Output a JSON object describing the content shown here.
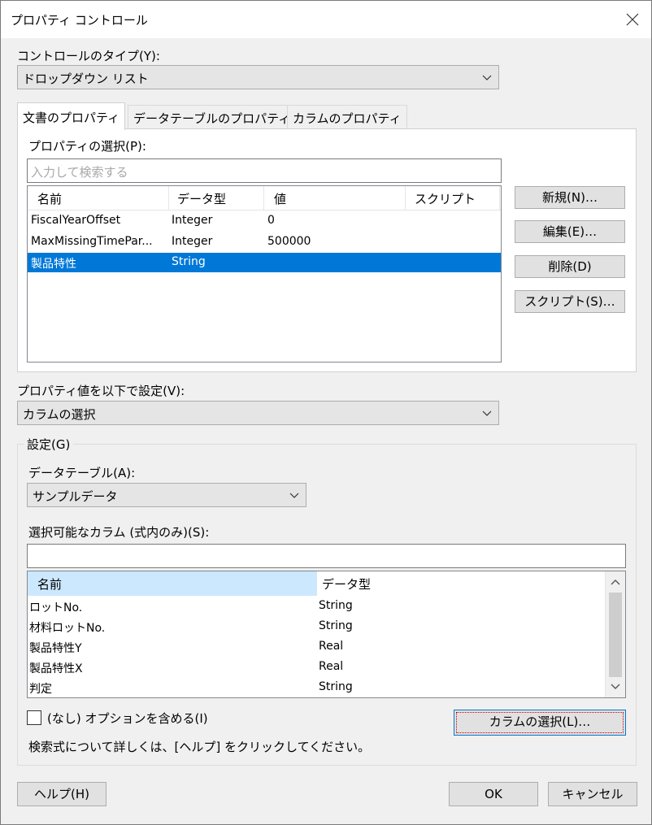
{
  "window": {
    "title": "プロパティ コントロール"
  },
  "control_type": {
    "label": "コントロールのタイプ(Y):",
    "value": "ドロップダウン リスト"
  },
  "tabs": [
    {
      "label": "文書のプロパティ",
      "active": true
    },
    {
      "label": "データテーブルのプロパティ",
      "active": false
    },
    {
      "label": "カラムのプロパティ",
      "active": false
    }
  ],
  "property_select": {
    "label": "プロパティの選択(P):",
    "search_placeholder": "入力して検索する",
    "columns": [
      "名前",
      "データ型",
      "値",
      "スクリプト"
    ],
    "rows": [
      {
        "name": "FiscalYearOffset",
        "type": "Integer",
        "value": "0",
        "script": "",
        "selected": false
      },
      {
        "name": "MaxMissingTimePar...",
        "type": "Integer",
        "value": "500000",
        "script": "",
        "selected": false
      },
      {
        "name": "製品特性",
        "type": "String",
        "value": "",
        "script": "",
        "selected": true
      }
    ]
  },
  "side_buttons": {
    "new": "新規(N)…",
    "edit": "編集(E)…",
    "delete": "削除(D)",
    "script": "スクリプト(S)…"
  },
  "set_value": {
    "label": "プロパティ値を以下で設定(V):",
    "value": "カラムの選択"
  },
  "settings": {
    "group_label": "設定(G)",
    "datatable_label": "データテーブル(A):",
    "datatable_value": "サンプルデータ",
    "available_columns_label": "選択可能なカラム (式内のみ)(S):",
    "search_value": "",
    "columns": [
      "名前",
      "データ型"
    ],
    "rows": [
      {
        "name": "ロットNo.",
        "type": "String"
      },
      {
        "name": "材料ロットNo.",
        "type": "String"
      },
      {
        "name": "製品特性Y",
        "type": "Real"
      },
      {
        "name": "製品特性X",
        "type": "Real"
      },
      {
        "name": "判定",
        "type": "String"
      }
    ],
    "include_none_label": "(なし) オプションを含める(I)",
    "include_none_checked": false,
    "select_columns_button": "カラムの選択(L)…",
    "help_text": "検索式について詳しくは、[ヘルプ] をクリックしてください。"
  },
  "footer": {
    "help": "ヘルプ(H)",
    "ok": "OK",
    "cancel": "キャンセル"
  },
  "colors": {
    "selection": "#0078d7",
    "header_highlight": "#cce8ff",
    "focus_dotted": "#cc0000",
    "focus_border": "#0078d7"
  },
  "icons": {
    "close": "close-icon",
    "chevron": "chevron-down-icon",
    "scroll_up": "chevron-up-icon",
    "scroll_down": "chevron-down-icon"
  }
}
